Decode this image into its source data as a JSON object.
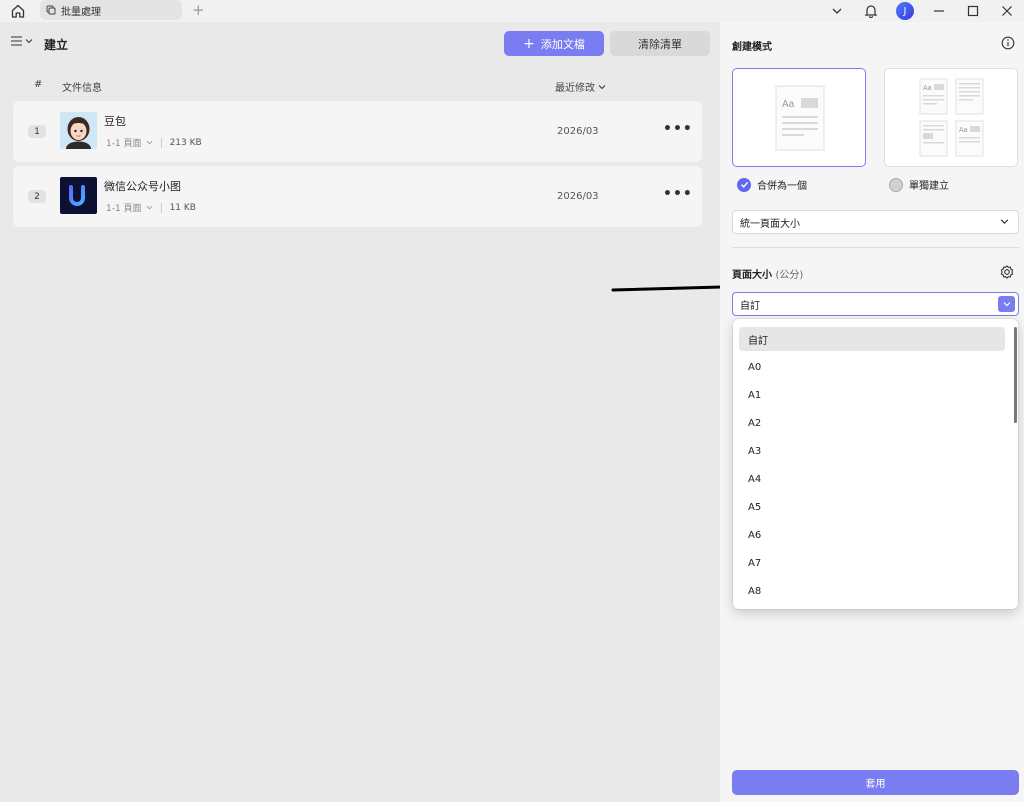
{
  "titlebar": {
    "tab_label": "批量處理"
  },
  "toolbar": {
    "title": "建立",
    "add_label": "添加文檔",
    "clear_label": "清除清單"
  },
  "columns": {
    "hash": "#",
    "info": "文件信息",
    "modified": "最近修改"
  },
  "files": [
    {
      "index": "1",
      "name": "豆包",
      "pages": "1-1 頁面",
      "size": "213 KB",
      "date": "2026/03"
    },
    {
      "index": "2",
      "name": "微信公众号小图",
      "pages": "1-1 頁面",
      "size": "11 KB",
      "date": "2026/03"
    }
  ],
  "panel": {
    "title": "創建模式",
    "merge_label": "合併為一個",
    "separate_label": "單獨建立",
    "page_size_mode": "統一頁面大小",
    "size_label": "頁面大小",
    "size_unit": "(公分)",
    "size_value": "自訂",
    "apply_label": "套用",
    "card_thumb_text": "Aa"
  },
  "dropdown": {
    "options": [
      "自訂",
      "A0",
      "A1",
      "A2",
      "A3",
      "A4",
      "A5",
      "A6",
      "A7",
      "A8"
    ],
    "selected_index": 0
  },
  "user": {
    "initial": "J"
  },
  "colors": {
    "accent": "#7a7cf2",
    "check": "#6366f1"
  }
}
